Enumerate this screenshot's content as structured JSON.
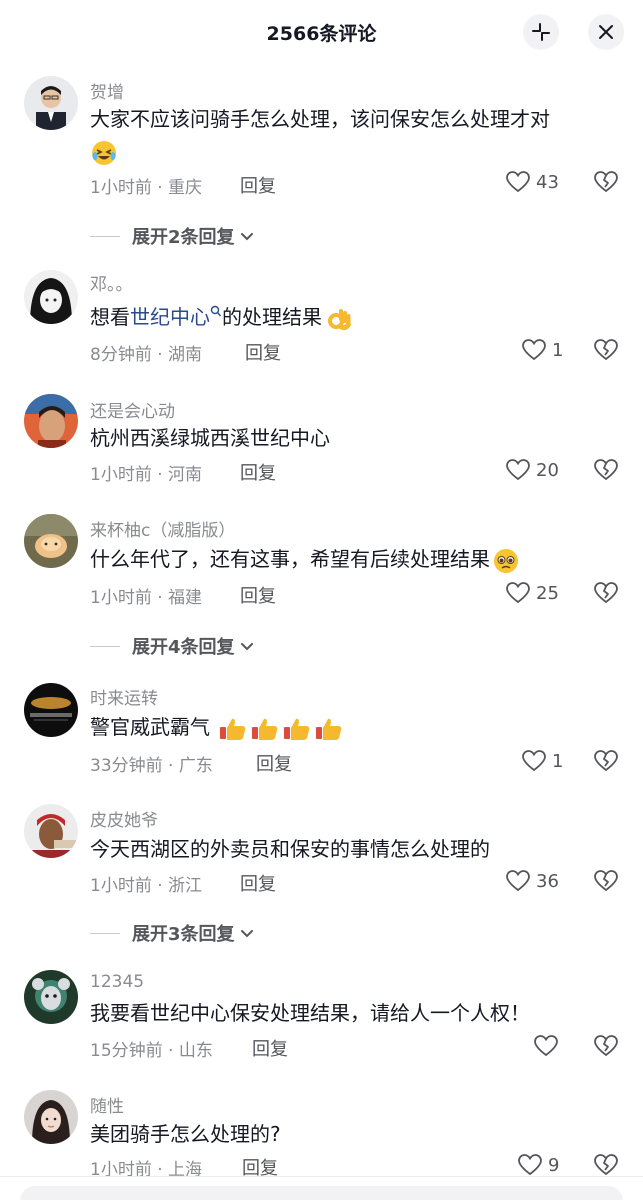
{
  "header": {
    "title": "2566条评论",
    "collapse_icon": "collapse-icon",
    "close_icon": "close-icon"
  },
  "colors": {
    "text": "#161823",
    "secondary": "#8a8b91",
    "link": "#2a4a8e",
    "button_bg": "#f2f2f4"
  },
  "comments": [
    {
      "username": "贺增",
      "text_line1": "大家不应该问骑手怎么处理，该问保安怎么处理才对",
      "emoji": "crying-laughing-emoji",
      "meta": "1小时前 · 重庆",
      "reply_label": "回复",
      "likes": "43",
      "expand_label": "展开2条回复"
    },
    {
      "username": "邓。。",
      "text_before": "想看",
      "text_link": "世纪中心",
      "text_after": "的处理结果",
      "emoji": "ok-hand-emoji",
      "meta": "8分钟前 · 湖南",
      "reply_label": "回复",
      "likes": "1"
    },
    {
      "username": "还是会心动",
      "text": "杭州西溪绿城西溪世纪中心",
      "meta": "1小时前 · 河南",
      "reply_label": "回复",
      "likes": "20"
    },
    {
      "username": "来杯柚c（减脂版）",
      "text": "什么年代了，还有这事，希望有后续处理结果",
      "emoji": "pleading-emoji",
      "meta": "1小时前 · 福建",
      "reply_label": "回复",
      "likes": "25",
      "expand_label": "展开4条回复"
    },
    {
      "username": "时来运转",
      "text": "警官威武霸气",
      "emoji": "thumbs-up-emoji",
      "meta": "33分钟前 · 广东",
      "reply_label": "回复",
      "likes": "1"
    },
    {
      "username": "皮皮她爷",
      "text": "今天西湖区的外卖员和保安的事情怎么处理的",
      "meta": "1小时前 · 浙江",
      "reply_label": "回复",
      "likes": "36",
      "expand_label": "展开3条回复"
    },
    {
      "username": "12345",
      "text": "我要看世纪中心保安处理结果，请给人一个人权！",
      "meta": "15分钟前 · 山东",
      "reply_label": "回复",
      "likes": ""
    },
    {
      "username": "随性",
      "text": "美团骑手怎么处理的?",
      "meta": "1小时前 · 上海",
      "reply_label": "回复",
      "likes": "9"
    }
  ]
}
